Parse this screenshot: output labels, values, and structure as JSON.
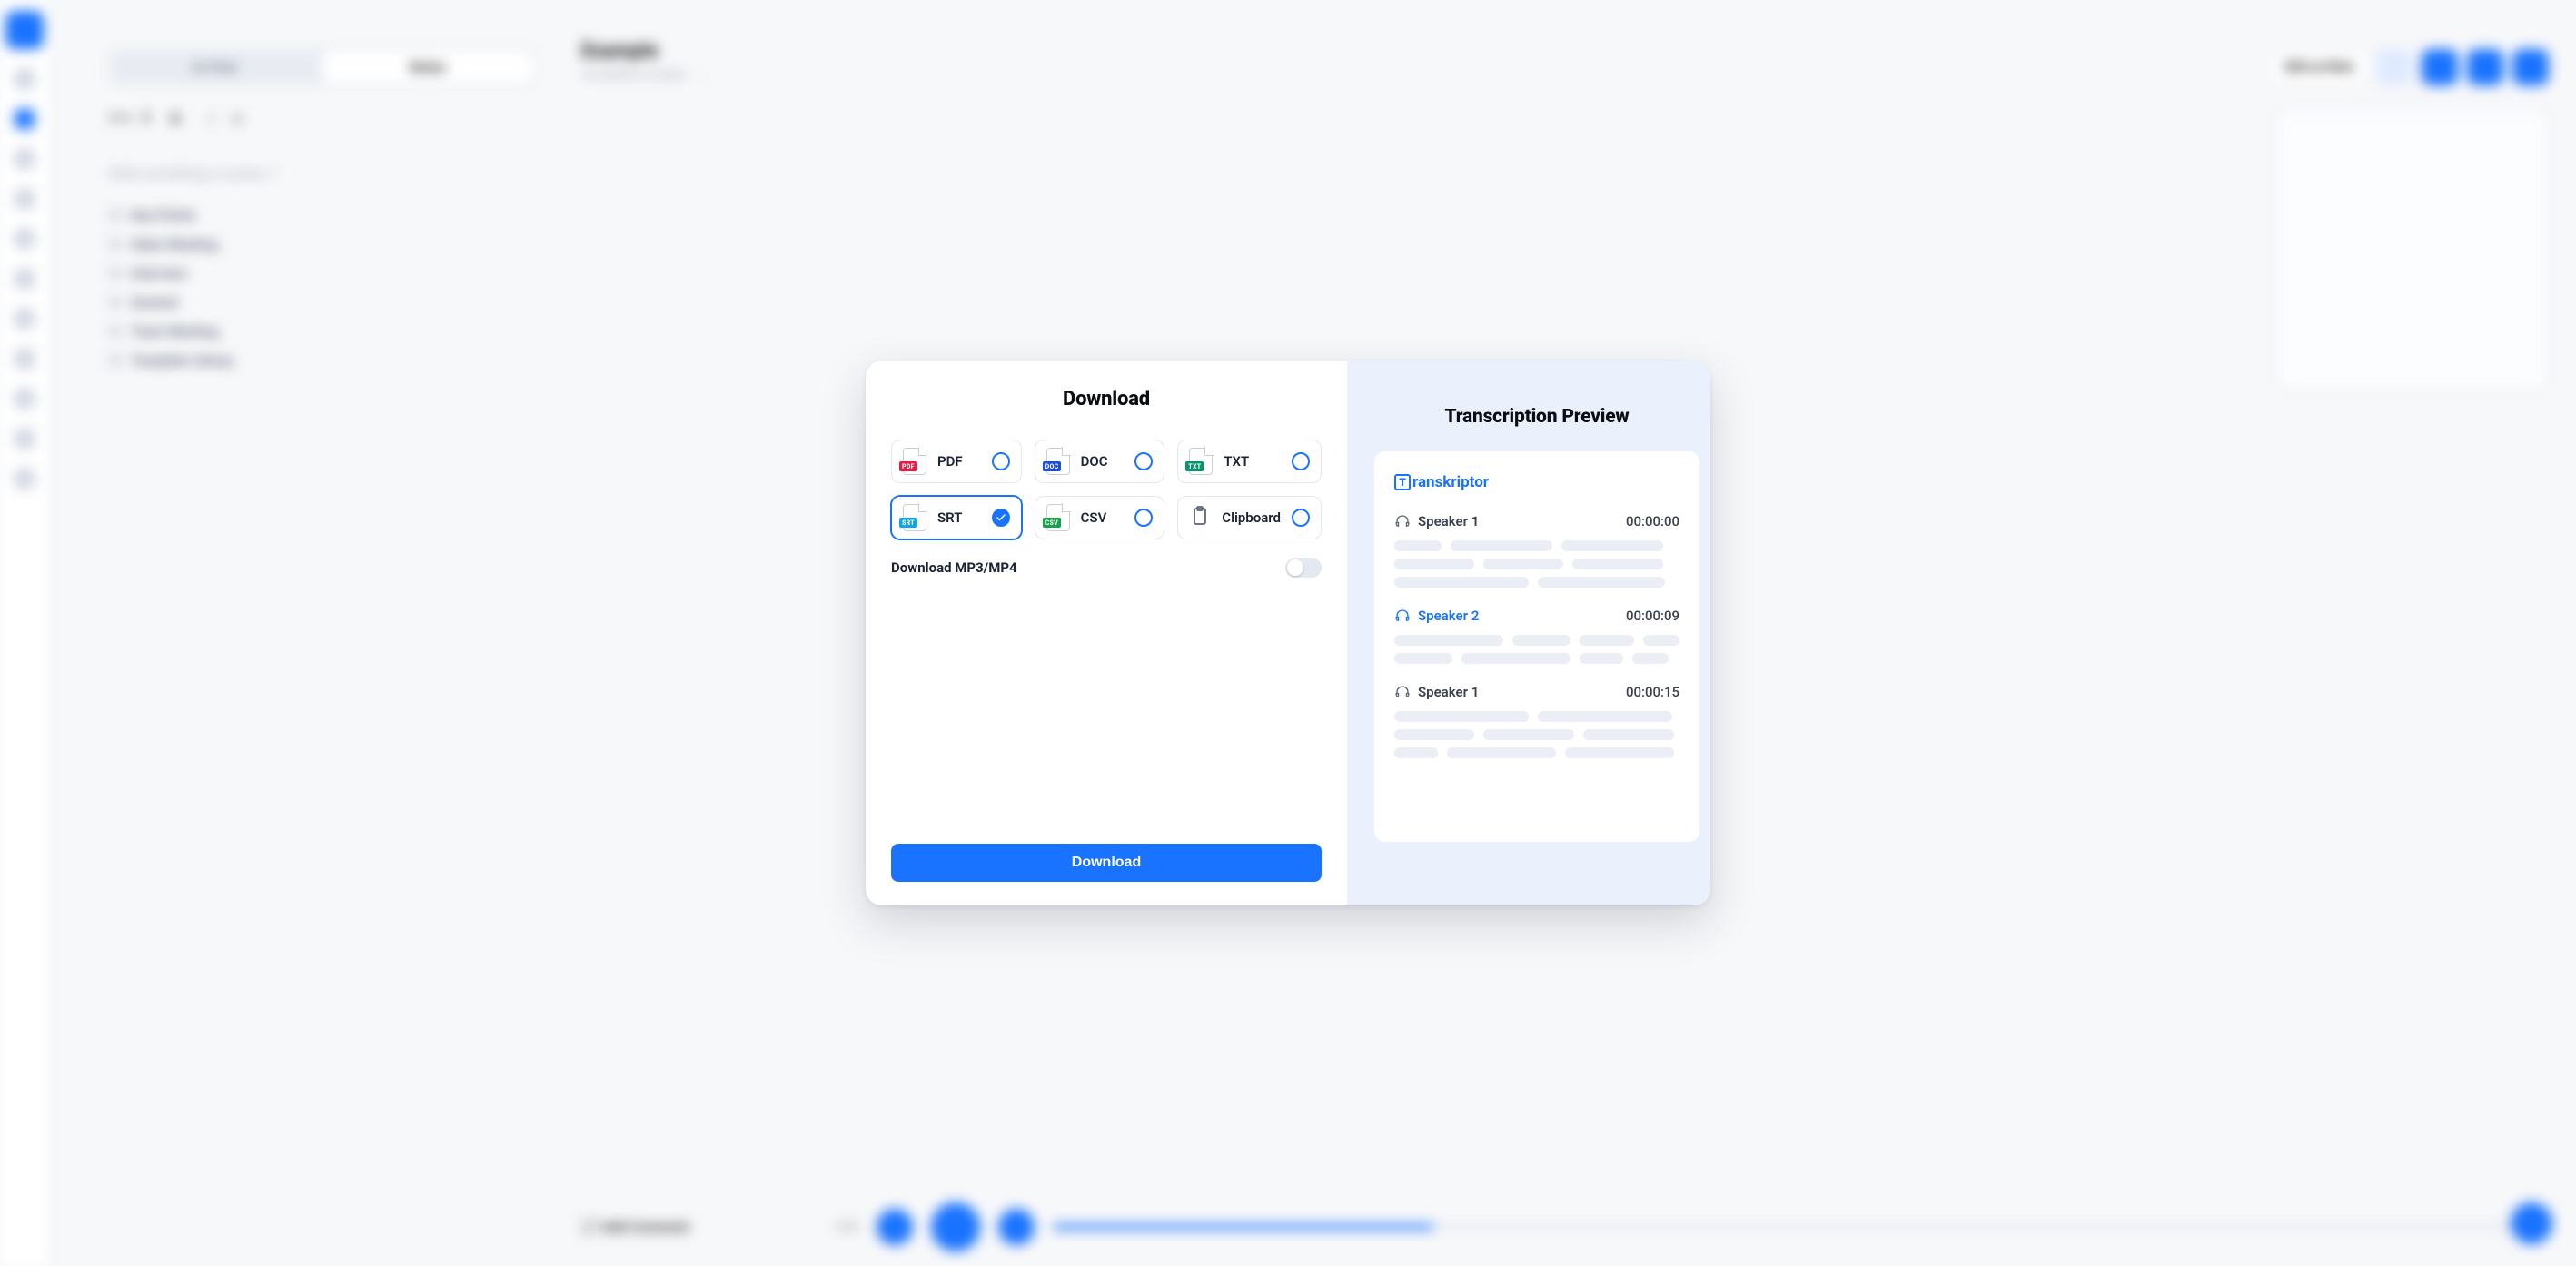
{
  "modal": {
    "title": "Download",
    "formats": [
      {
        "id": "pdf",
        "label": "PDF",
        "tag": "PDF",
        "tag_class": "pdf",
        "selected": false
      },
      {
        "id": "doc",
        "label": "DOC",
        "tag": "DOC",
        "tag_class": "doc",
        "selected": false
      },
      {
        "id": "txt",
        "label": "TXT",
        "tag": "TXT",
        "tag_class": "txt",
        "selected": false
      },
      {
        "id": "srt",
        "label": "SRT",
        "tag": "SRT",
        "tag_class": "srt",
        "selected": true
      },
      {
        "id": "csv",
        "label": "CSV",
        "tag": "CSV",
        "tag_class": "csv",
        "selected": false
      },
      {
        "id": "clipboard",
        "label": "Clipboard",
        "tag": null,
        "tag_class": null,
        "selected": false
      }
    ],
    "download_media_label": "Download MP3/MP4",
    "download_media_enabled": false,
    "download_button": "Download"
  },
  "preview": {
    "title": "Transcription Preview",
    "brand": "ranskriptor",
    "segments": [
      {
        "speaker": "Speaker 1",
        "time": "00:00:00",
        "accent": false,
        "lines": [
          [
            52,
            112,
            112
          ],
          [
            88,
            88,
            100
          ],
          [
            148,
            140
          ]
        ]
      },
      {
        "speaker": "Speaker 2",
        "time": "00:00:09",
        "accent": true,
        "lines": [
          [
            120,
            64,
            60,
            40
          ],
          [
            64,
            120,
            48,
            40
          ]
        ]
      },
      {
        "speaker": "Speaker 1",
        "time": "00:00:15",
        "accent": false,
        "lines": [
          [
            148,
            148
          ],
          [
            88,
            100,
            100
          ],
          [
            48,
            120,
            120
          ]
        ]
      }
    ]
  },
  "background": {
    "tab_left": "AI Chat",
    "tab_right": "Notes",
    "doc_title": "Example",
    "placeholder": "Write something, or press '/'",
    "edit_button": "Edit as Note",
    "add_comment": "Add Comment",
    "bullets": [
      "Key Points",
      "Sales Meeting",
      "Interview",
      "General",
      "Team Meeting",
      "Template Library"
    ]
  }
}
